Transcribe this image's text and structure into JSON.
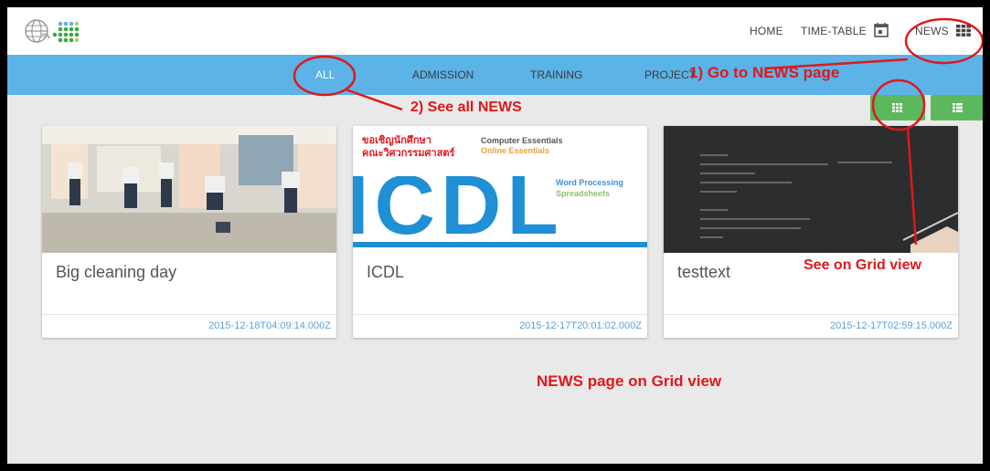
{
  "nav": {
    "home": "HOME",
    "timetable": "TIME-TABLE",
    "news": "NEWS"
  },
  "categories": [
    "ALL",
    "ADMISSION",
    "TRAINING",
    "PROJECT"
  ],
  "cards": [
    {
      "title": "Big cleaning day",
      "date": "2015-12-18T04:09:14.000Z"
    },
    {
      "title": "ICDL",
      "date": "2015-12-17T20:01:02.000Z",
      "thumb": {
        "thai_line1": "ขอเชิญนักศึกษา",
        "thai_line2": "คณะวิศวกรรมศาสตร์",
        "line1": "Computer Essentials",
        "line2": "Online Essentials",
        "line3": "Word Processing",
        "line4": "Spreadsheets",
        "big": "ICDL"
      }
    },
    {
      "title": "testtext",
      "date": "2015-12-17T02:59:15.000Z"
    }
  ],
  "annotations": {
    "step1": "1) Go to NEWS page",
    "step2": "2) See all NEWS",
    "grid": "See on Grid view",
    "footer": "NEWS page on Grid view"
  },
  "colors": {
    "catbar": "#5bb3e8",
    "toggle": "#5cb85c",
    "annotation": "#e0181b",
    "date": "#5aa0d8"
  },
  "icons": [
    "globe-logo-icon",
    "calendar-icon",
    "grid-icon",
    "list-icon"
  ]
}
